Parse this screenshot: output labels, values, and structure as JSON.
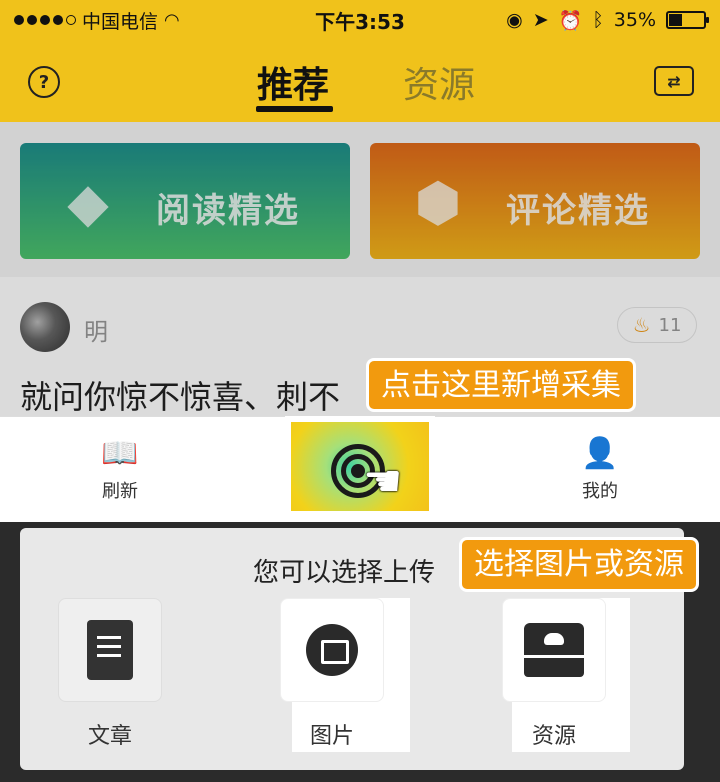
{
  "status_bar": {
    "carrier": "中国电信",
    "time": "下午3:53",
    "battery_text": "35%",
    "battery_level": 0.35
  },
  "nav": {
    "tabs": [
      {
        "label": "推荐",
        "active": true
      },
      {
        "label": "资源",
        "active": false
      }
    ],
    "help_icon": "question-circle-icon",
    "switch_icon": "swap-icon"
  },
  "cards": [
    {
      "label": "阅读精选",
      "icon": "diamond-icon",
      "colors": [
        "#1e8f8c",
        "#4cc26c"
      ]
    },
    {
      "label": "评论精选",
      "icon": "flame-hexagon-icon",
      "colors": [
        "#e06a1a",
        "#f2b51a"
      ]
    }
  ],
  "post": {
    "author": "明",
    "hot_count": "11",
    "text": "就问你惊不惊喜、刺不"
  },
  "tab_bar": {
    "items": [
      {
        "label": "刷新",
        "icon": "book-icon"
      },
      {
        "label": "我的",
        "icon": "person-icon"
      }
    ]
  },
  "callouts": {
    "add": "点击这里新增采集",
    "choose": "选择图片或资源"
  },
  "sheet": {
    "title": "您可以选择上传",
    "options": [
      {
        "label": "文章",
        "icon": "document-icon"
      },
      {
        "label": "图片",
        "icon": "image-icon"
      },
      {
        "label": "资源",
        "icon": "drive-icon"
      }
    ]
  },
  "colors": {
    "brand_yellow": "#f0c21b",
    "callout_orange": "#f29a0e"
  }
}
